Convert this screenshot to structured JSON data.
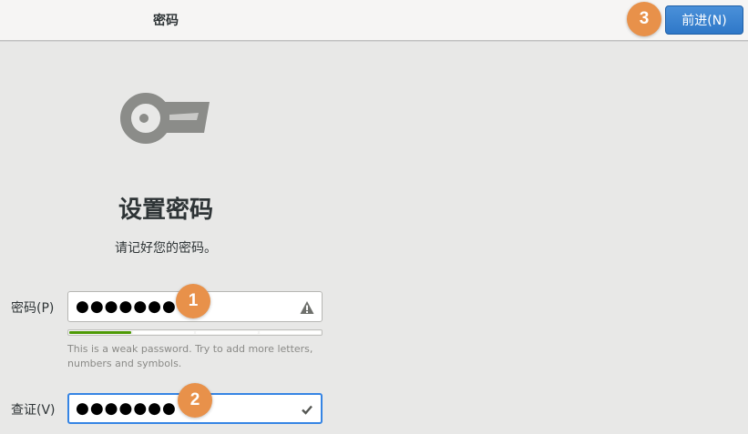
{
  "header": {
    "title": "密码",
    "next_label": "前进(N)"
  },
  "main": {
    "title": "设置密码",
    "subtitle": "请记好您的密码。"
  },
  "password_field": {
    "label": "密码(P)",
    "value_masked": "●●●●●●●",
    "status_icon": "warning-icon"
  },
  "strength": {
    "level": 0.25,
    "hint": "This is a weak password. Try to add more letters, numbers and symbols."
  },
  "verify_field": {
    "label": "查证(V)",
    "value_masked": "●●●●●●●",
    "status_icon": "checkmark-icon"
  },
  "badges": [
    "1",
    "2",
    "3"
  ],
  "colors": {
    "accent": "#3584e4",
    "badge": "#e8914a",
    "strength_fill": "#4e9a06"
  }
}
